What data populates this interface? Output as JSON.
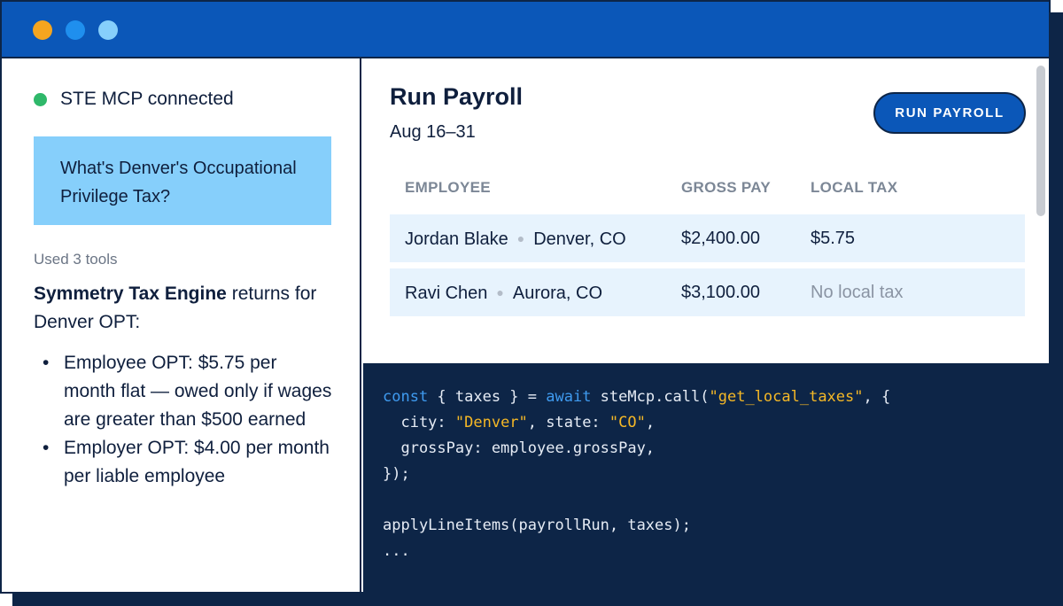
{
  "colors": {
    "titlebar": "#0b57b8",
    "dot_1": "#f5a51f",
    "dot_2": "#1f8fee",
    "dot_3": "#86cffb",
    "status_connected": "#2fb86a",
    "code_background": "#0d2547",
    "code_keyword": "#3f9bf0",
    "code_string": "#f5b826"
  },
  "icons": {
    "window_dots": [
      "window-close-dot-icon",
      "window-minimize-dot-icon",
      "window-maximize-dot-icon"
    ],
    "status": "status-dot-icon"
  },
  "chat": {
    "status_text": "STE MCP connected",
    "question": "What's Denver's Occupational Privilege Tax?",
    "tools_used": "Used 3 tools",
    "answer_bold": "Symmetry Tax Engine",
    "answer_rest": "returns for Denver OPT:",
    "bullets": [
      "Employee OPT: $5.75 per month flat — owed only if wages are greater than $500 earned",
      "Employer OPT: $4.00 per month per liable employee"
    ]
  },
  "payroll": {
    "title": "Run Payroll",
    "date_range": "Aug 16–31",
    "run_button": "RUN PAYROLL",
    "columns": {
      "employee": "EMPLOYEE",
      "gross_pay": "GROSS PAY",
      "local_tax": "LOCAL TAX"
    },
    "rows": [
      {
        "name": "Jordan Blake",
        "location": "Denver, CO",
        "gross_pay": "$2,400.00",
        "local_tax": "$5.75"
      },
      {
        "name": "Ravi Chen",
        "location": "Aurora, CO",
        "gross_pay": "$3,100.00",
        "local_tax": "No local tax"
      }
    ]
  },
  "code": {
    "l1_kw1": "const",
    "l1_a": " { taxes } = ",
    "l1_kw2": "await",
    "l1_b": " steMcp.call(",
    "l1_str": "\"get_local_taxes\"",
    "l1_c": ", {",
    "l2_a": "  city: ",
    "l2_str1": "\"Denver\"",
    "l2_b": ", state: ",
    "l2_str2": "\"CO\"",
    "l2_c": ",",
    "l3": "  grossPay: employee.grossPay,",
    "l4": "});",
    "l5": "",
    "l6": "applyLineItems(payrollRun, taxes);",
    "l7": "..."
  }
}
